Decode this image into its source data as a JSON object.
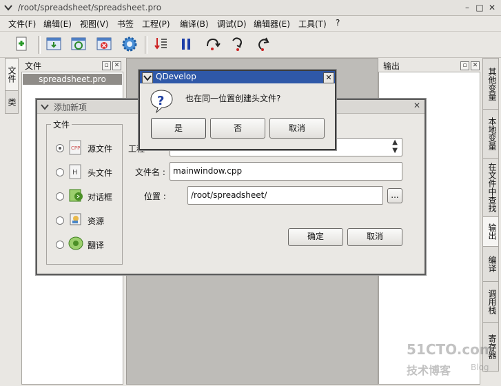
{
  "window": {
    "title": "/root/spreadsheet/spreadsheet.pro",
    "min_glyph": "–",
    "max_glyph": "□",
    "close_glyph": "✕"
  },
  "menu": [
    {
      "label": "文件(F)"
    },
    {
      "label": "编辑(E)"
    },
    {
      "label": "视图(V)"
    },
    {
      "label": "书签"
    },
    {
      "label": "工程(P)"
    },
    {
      "label": "编译(B)"
    },
    {
      "label": "调试(D)"
    },
    {
      "label": "编辑器(E)"
    },
    {
      "label": "工具(T)"
    },
    {
      "label": "?"
    }
  ],
  "left_tabs": [
    "文件",
    "类"
  ],
  "file_dock": {
    "title": "文件",
    "selected": "spreadsheet.pro"
  },
  "output_dock": {
    "title": "输出"
  },
  "right_tabs": [
    "其他变量",
    "本地变量",
    "在文件中查找",
    "输出",
    "编译",
    "调用栈",
    "寄存器"
  ],
  "add_dialog": {
    "title": "添加新项",
    "group_label": "文件",
    "types": [
      {
        "label": "源文件",
        "icon": "cpp-source-icon",
        "checked": true
      },
      {
        "label": "头文件",
        "icon": "header-file-icon",
        "checked": false
      },
      {
        "label": "对话框",
        "icon": "dialog-form-icon",
        "checked": false
      },
      {
        "label": "资源",
        "icon": "resource-icon",
        "checked": false
      },
      {
        "label": "翻译",
        "icon": "translation-icon",
        "checked": false
      }
    ],
    "project_label": "工程",
    "filename_label": "文件名 :",
    "filename_value": "mainwindow.cpp",
    "location_label": "位置 :",
    "location_value": "/root/spreadsheet/",
    "browse_label": "...",
    "ok_label": "确定",
    "cancel_label": "取消"
  },
  "question_dialog": {
    "title": "QDevelop",
    "message": "也在同一位置创建头文件?",
    "yes_label": "是",
    "no_label": "否",
    "cancel_label": "取消"
  },
  "watermark": {
    "line1": "51CTO.com",
    "line2": "技术博客",
    "line3": "Blog"
  },
  "colors": {
    "title_blue": "#2f58a8",
    "selection": "#8f8c88"
  }
}
